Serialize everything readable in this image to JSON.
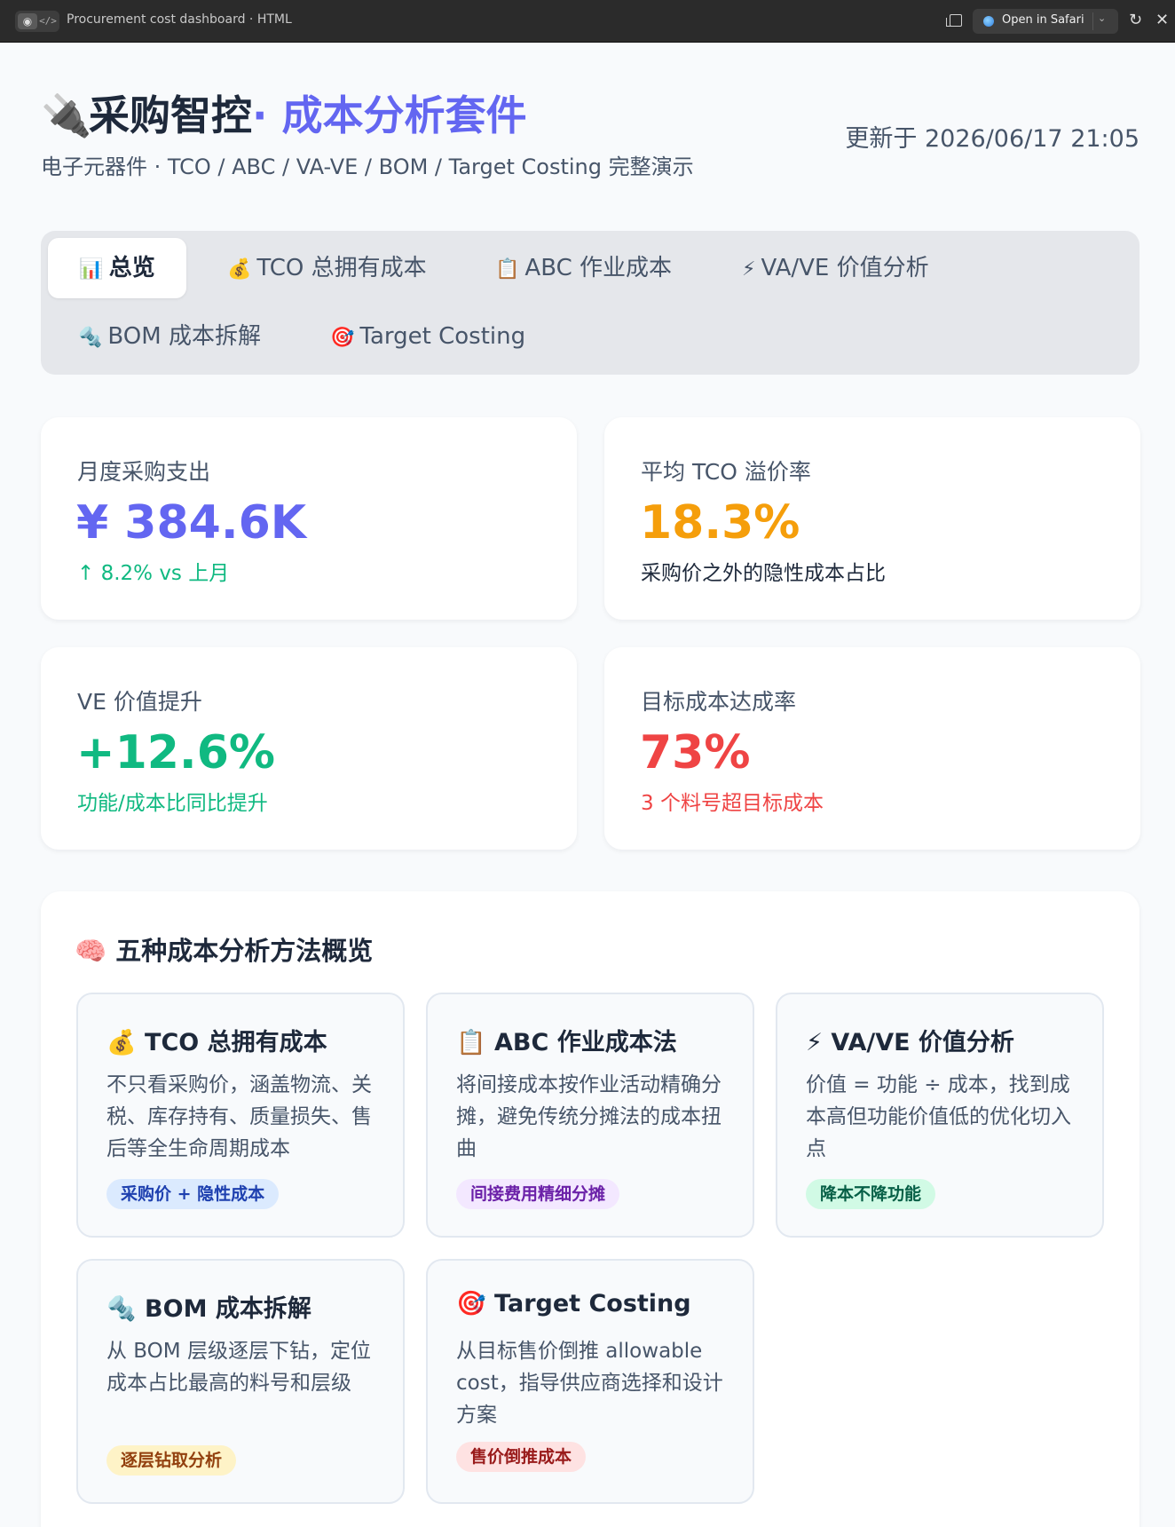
{
  "window": {
    "title": "Procurement cost dashboard · HTML",
    "open_label": "Open in Safari"
  },
  "header": {
    "title_main": "采购智控",
    "title_accent": "· 成本分析套件",
    "subtitle": "电子元器件 · TCO / ABC / VA-VE / BOM / Target Costing 完整演示",
    "updated": "更新于 2026/06/17 21:05"
  },
  "tabs": [
    {
      "icon": "📊",
      "label": "总览"
    },
    {
      "icon": "💰",
      "label": "TCO 总拥有成本"
    },
    {
      "icon": "📋",
      "label": "ABC 作业成本"
    },
    {
      "icon": "⚡",
      "label": "VA/VE 价值分析"
    },
    {
      "icon": "🔩",
      "label": "BOM 成本拆解"
    },
    {
      "icon": "🎯",
      "label": "Target Costing"
    }
  ],
  "kpis": [
    {
      "label": "月度采购支出",
      "value": "¥ 384.6K",
      "note": "↑ 8.2% vs 上月",
      "value_color": "#6366f1",
      "note_color": "#10b981"
    },
    {
      "label": "平均 TCO 溢价率",
      "value": "18.3%",
      "note": "采购价之外的隐性成本占比",
      "value_color": "#f59e0b",
      "note_color": "#1e293b"
    },
    {
      "label": "VE 价值提升",
      "value": "+12.6%",
      "note": "功能/成本比同比提升",
      "value_color": "#10b981",
      "note_color": "#10b981"
    },
    {
      "label": "目标成本达成率",
      "value": "73%",
      "note": "3 个料号超目标成本",
      "value_color": "#ef4444",
      "note_color": "#ef4444"
    }
  ],
  "methods": {
    "icon": "🧠",
    "title": "五种成本分析方法概览",
    "cards": [
      {
        "icon": "💰",
        "title": "TCO 总拥有成本",
        "desc": "不只看采购价，涵盖物流、关税、库存持有、质量损失、售后等全生命周期成本",
        "tag": "采购价 + 隐性成本",
        "tag_bg": "#dbeafe",
        "tag_color": "#1e40af"
      },
      {
        "icon": "📋",
        "title": "ABC 作业成本法",
        "desc": "将间接成本按作业活动精确分摊，避免传统分摊法的成本扭曲",
        "tag": "间接费用精细分摊",
        "tag_bg": "#f3e8ff",
        "tag_color": "#6b21a8"
      },
      {
        "icon": "⚡",
        "title": "VA/VE 价值分析",
        "desc": "价值 = 功能 ÷ 成本，找到成本高但功能价值低的优化切入点",
        "tag": "降本不降功能",
        "tag_bg": "#d1fae5",
        "tag_color": "#065f46"
      },
      {
        "icon": "🔩",
        "title": "BOM 成本拆解",
        "desc": "从 BOM 层级逐层下钻，定位成本占比最高的料号和层级",
        "tag": "逐层钻取分析",
        "tag_bg": "#fef3c7",
        "tag_color": "#92400e"
      },
      {
        "icon": "🎯",
        "title": "Target Costing",
        "desc": "从目标售价倒推 allowable cost，指导供应商选择和设计方案",
        "tag": "售价倒推成本",
        "tag_bg": "#fee2e2",
        "tag_color": "#991b1b"
      }
    ]
  }
}
